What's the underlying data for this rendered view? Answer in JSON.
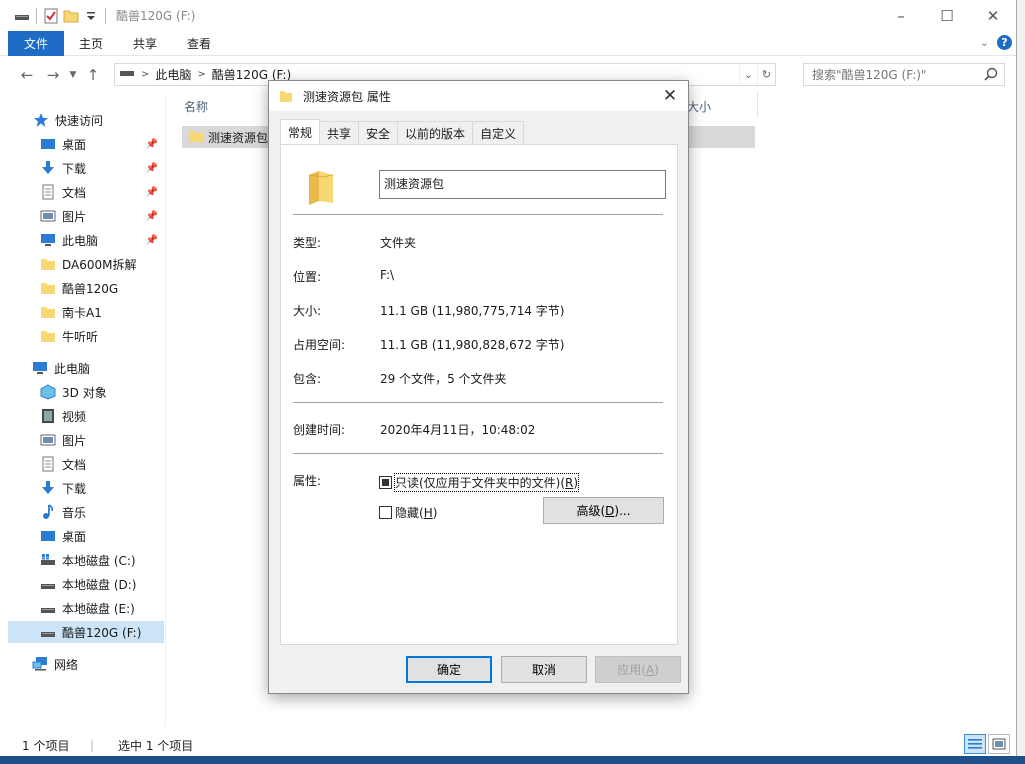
{
  "explorer": {
    "title": "酷兽120G (F:)",
    "ribbon": {
      "file": "文件",
      "home": "主页",
      "share": "共享",
      "view": "查看"
    },
    "address": {
      "crumb1": "此电脑",
      "crumb2": "酷兽120G (F:)"
    },
    "search_placeholder": "搜索\"酷兽120G (F:)\"",
    "sidebar": {
      "quick_access": "快速访问",
      "desktop": "桌面",
      "downloads": "下载",
      "documents": "文档",
      "pictures": "图片",
      "this_pc_pinned": "此电脑",
      "folder1": "DA600M拆解",
      "folder2": "酷兽120G",
      "folder3": "南卡A1",
      "folder4": "牛听听",
      "this_pc": "此电脑",
      "objects3d": "3D 对象",
      "videos": "视频",
      "pictures2": "图片",
      "documents2": "文档",
      "downloads2": "下载",
      "music": "音乐",
      "desktop2": "桌面",
      "disk_c": "本地磁盘 (C:)",
      "disk_d": "本地磁盘 (D:)",
      "disk_e": "本地磁盘 (E:)",
      "disk_f": "酷兽120G (F:)",
      "network": "网络"
    },
    "columns": {
      "name": "名称",
      "size": "大小"
    },
    "file_name": "测速资源包",
    "status": {
      "count": "1 个项目",
      "selected": "选中 1 个项目"
    }
  },
  "dialog": {
    "title": "测速资源包 属性",
    "tabs": [
      "常规",
      "共享",
      "安全",
      "以前的版本",
      "自定义"
    ],
    "name": "测速资源包",
    "props": {
      "type_label": "类型:",
      "type_value": "文件夹",
      "location_label": "位置:",
      "location_value": "F:\\",
      "size_label": "大小:",
      "size_value": "11.1 GB (11,980,775,714 字节)",
      "disk_size_label": "占用空间:",
      "disk_size_value": "11.1 GB (11,980,828,672 字节)",
      "contains_label": "包含:",
      "contains_value": "29 个文件，5 个文件夹",
      "created_label": "创建时间:",
      "created_value": "2020年4月11日，10:48:02",
      "attrs_label": "属性:"
    },
    "readonly_text": "只读(仅应用于文件夹中的文件)(",
    "readonly_key": "R",
    "hidden_text": "隐藏(",
    "hidden_key": "H",
    "advanced_text": "高级(",
    "advanced_key": "D",
    "ok": "确定",
    "cancel": "取消",
    "apply_text": "应用(",
    "apply_key": "A"
  }
}
